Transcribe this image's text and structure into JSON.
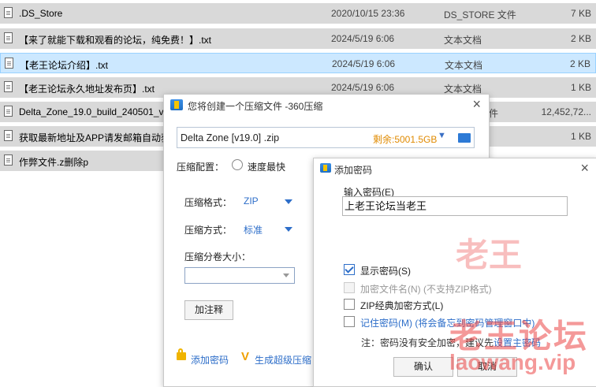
{
  "files": [
    {
      "name": ".DS_Store",
      "date": "2020/10/15 23:36",
      "type": "DS_STORE 文件",
      "size": "7 KB"
    },
    {
      "name": "【来了就能下载和观看的论坛，纯免费！】.txt",
      "date": "2024/5/19 6:06",
      "type": "文本文档",
      "size": "2 KB"
    },
    {
      "name": "【老王论坛介绍】.txt",
      "date": "2024/5/19 6:06",
      "type": "文本文档",
      "size": "2 KB"
    },
    {
      "name": "【老王论坛永久地址发布页】.txt",
      "date": "2024/5/19 6:06",
      "type": "文本文档",
      "size": "1 KB"
    },
    {
      "name": "Delta_Zone_19.0_build_240501_v",
      "date": "",
      "type": "件",
      "size": "12,452,72..."
    },
    {
      "name": "获取最新地址及APP请发邮箱自动获",
      "date": "",
      "type": "",
      "size": "1 KB"
    },
    {
      "name": "作弊文件.z删除p",
      "date": "",
      "type": "",
      "size": ""
    }
  ],
  "compress_dialog": {
    "title": "您将创建一个压缩文件 -360压缩",
    "path": "Delta Zone [v19.0] .zip",
    "free_space": "剩余:5001.5GB",
    "config_label": "压缩配置：",
    "speed_option": "速度最快",
    "format_label": "压缩格式：",
    "format_value": "ZIP",
    "method_label": "压缩方式：",
    "method_value": "标准",
    "volume_label": "压缩分卷大小：",
    "volume_value": "",
    "comment_button": "加注释",
    "add_password_link": "添加密码",
    "super_compress_link": "生成超级压缩"
  },
  "password_dialog": {
    "title": "添加密码",
    "input_label": "输入密码(E)",
    "password_value": "上老王论坛当老王",
    "show_password": "显示密码(S)",
    "show_password_checked": true,
    "encrypt_names": "加密文件名(N) (不支持ZIP格式)",
    "zip_classic": "ZIP经典加密方式(L)",
    "remember_password": "记住密码(M) (将会备忘到密码管理窗口中)",
    "note_prefix": "注：密码没有安全加密，建议先",
    "note_link": "设置主密码",
    "ok_button": "确认",
    "cancel_button": "取消"
  },
  "watermark": {
    "line1": "老王论坛",
    "line2": "laowang.vip",
    "line3": "老王"
  }
}
